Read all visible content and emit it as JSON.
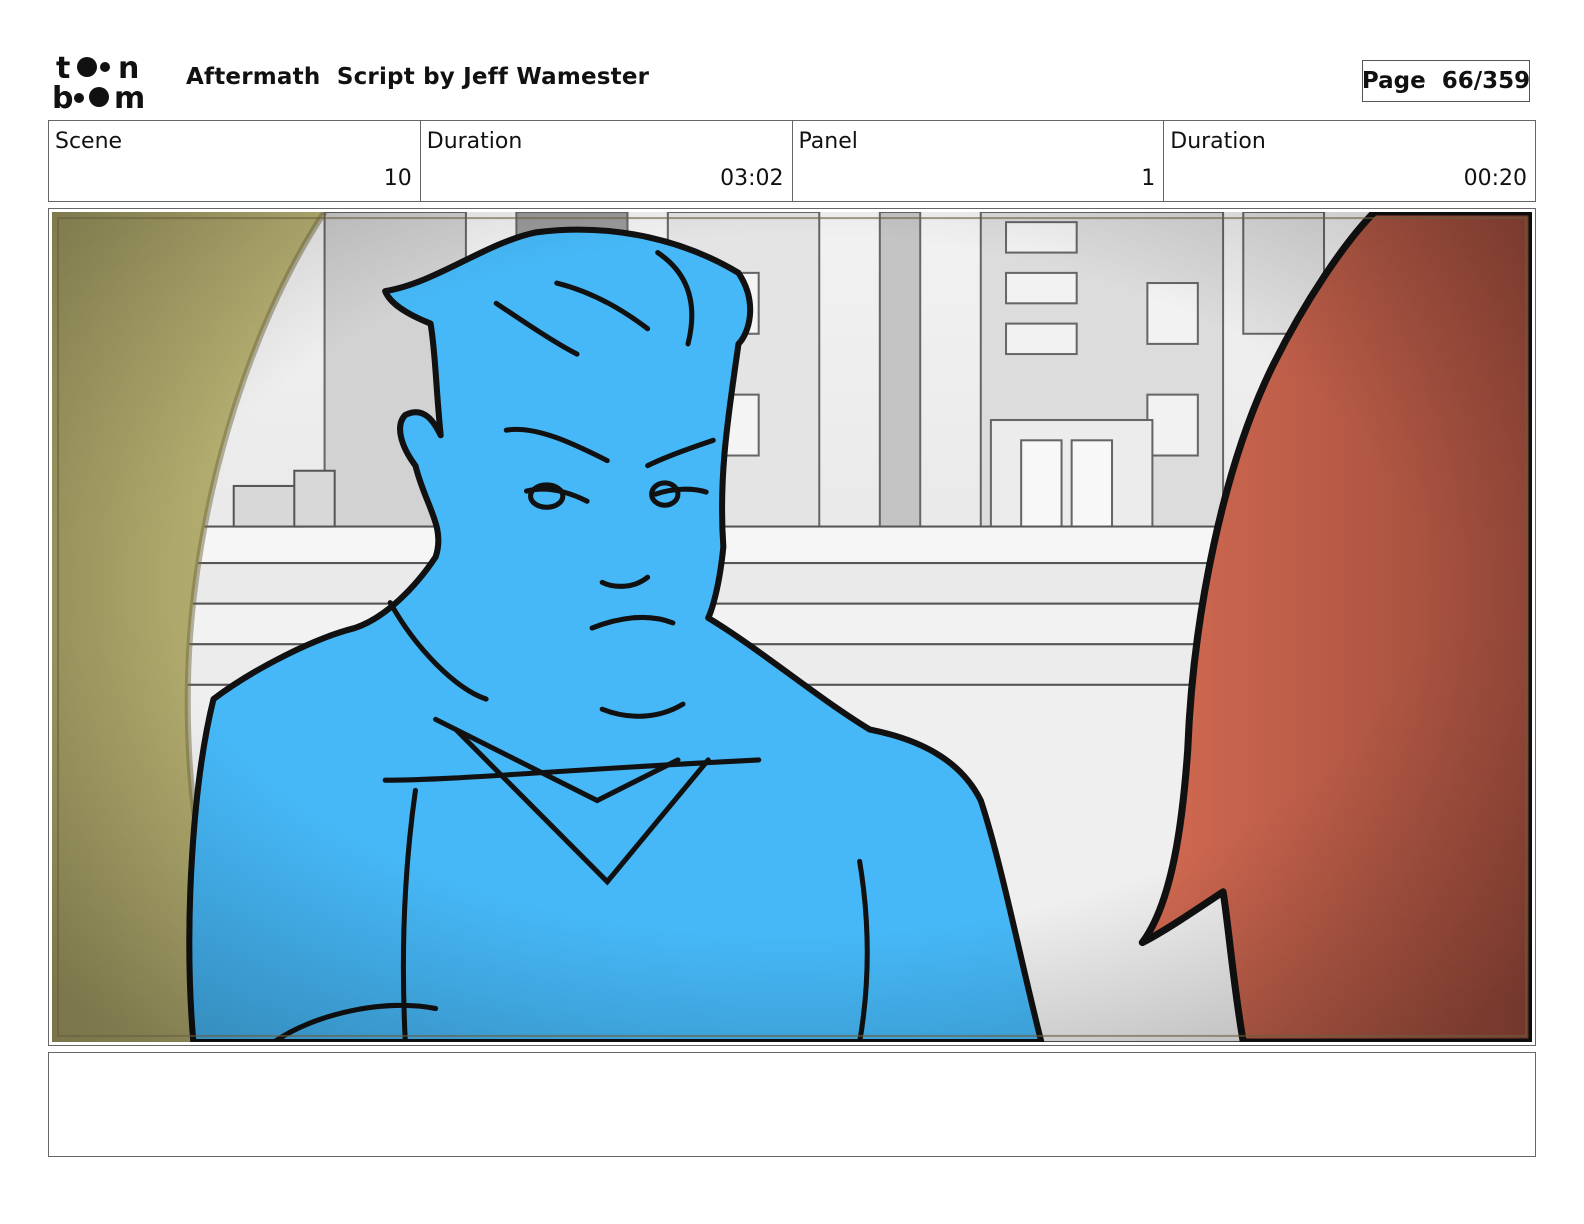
{
  "header": {
    "logo_top": "toon",
    "logo_bottom": "boom",
    "title": "Aftermath  Script by Jeff Wamester",
    "page_label": "Page  66/359"
  },
  "info": {
    "scene_label": "Scene",
    "scene_value": "10",
    "scene_duration_label": "Duration",
    "scene_duration_value": "03:02",
    "panel_label": "Panel",
    "panel_value": "1",
    "panel_duration_label": "Duration",
    "panel_duration_value": "00:20"
  },
  "panel_art": {
    "description_icon": "storyboard-panel-image",
    "colors": {
      "left_foreground": "#b4ad6f",
      "character": "#46b8f7",
      "right_foreground": "#c4604a",
      "background": "#e9e9e9"
    }
  },
  "notes": {
    "text": ""
  }
}
